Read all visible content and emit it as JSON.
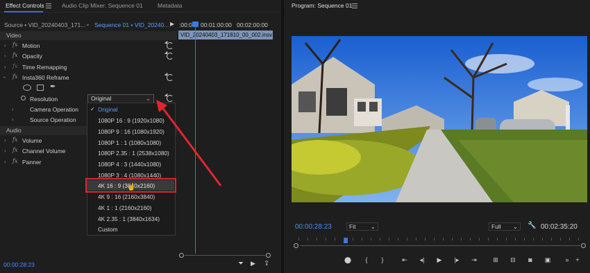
{
  "left_panel": {
    "tabs": [
      "Effect Controls",
      "Audio Clip Mixer: Sequence 01",
      "Metadata"
    ],
    "source_label": "Source • VID_20240403_171...",
    "sequence_label": "Sequence 01 • VID_20240...",
    "timeline_times": [
      ":00:00",
      "00:01:00:00",
      "00:02:00:00"
    ],
    "clip_name": "VID_20240403_171810_00_002.insv",
    "sections": {
      "video": "Video",
      "audio": "Audio"
    },
    "effects": [
      {
        "label": "Motion"
      },
      {
        "label": "Opacity"
      },
      {
        "label": "Time Remapping"
      },
      {
        "label": "Insta360 Reframe"
      }
    ],
    "resolution_label": "Resolution",
    "resolution_value": "Original",
    "camera_operation": "Camera Operation",
    "source_operation": "Source Operation",
    "audio_effects": [
      {
        "label": "Volume"
      },
      {
        "label": "Channel Volume"
      },
      {
        "label": "Panner"
      }
    ],
    "timecode": "00:00:28:23",
    "resolution_options": [
      "Original",
      "1080P 16 : 9 (1920x1080)",
      "1080P 9 : 16 (1080x1920)",
      "1080P 1 : 1 (1080x1080)",
      "1080P 2.35 : 1 (2538x1080)",
      "1080P 4 : 3 (1440x1080)",
      "1080P 3 : 4 (1080x1440)",
      "4K 16 : 9 (3840x2160)",
      "4K 9 : 16 (2160x3840)",
      "4K 1 : 1 (2160x2160)",
      "4K 2.35 : 1 (3840x1634)",
      "Custom"
    ]
  },
  "right_panel": {
    "title": "Program: Sequence 01",
    "current_timecode": "00:00:28:23",
    "fit_label": "Fit",
    "quality_label": "Full",
    "duration_timecode": "00:02:35:20"
  },
  "colors": {
    "accent_blue": "#4a8cff",
    "highlight_red": "#e0262f",
    "clip_bar": "#7c95b8"
  }
}
